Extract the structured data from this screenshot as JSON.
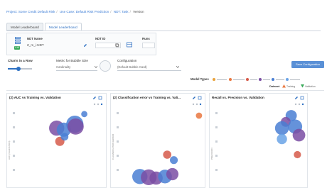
{
  "breadcrumb": {
    "items": [
      "Project: Some Credit Default Risk",
      "Use Case: Default Risk Prediction",
      "NDT: Task",
      "Version"
    ]
  },
  "tabs": [
    {
      "label": "Model Leaderboard",
      "active": false
    },
    {
      "label": "Model Leaderboard",
      "active": true
    }
  ],
  "info": {
    "ndt_name_label": "NDT Name",
    "ndt_name_value": "rt_m_i-NDT",
    "ndt_badge": "CID",
    "ndt_id_label": "NDT ID",
    "runs_label": "Runs"
  },
  "controls": {
    "charts_in_row_label": "Charts in a Row",
    "charts_in_row_value": 0.45,
    "metric_size_label": "Metric for Bubble Size",
    "metric_size_value": "Cardinality",
    "config_label": "Configuration",
    "config_value": "(Default Bubble Card)",
    "save_button_label": "Save Configuration"
  },
  "legend": {
    "model_types_label": "Model Types",
    "dataset_label": "Dataset",
    "dataset_train_label": "Training",
    "dataset_val_label": "Validation"
  },
  "colors": {
    "blue": "#4a7fd4",
    "light_blue": "#6aa3e6",
    "purple": "#7a4ea3",
    "orange": "#e9773f",
    "red": "#d65a4a",
    "green": "#3aaa5a",
    "accent": "#2c6fc2"
  },
  "panels": [
    {
      "title": "(2) AUC vs Training vs. Validation",
      "ylabel": "AUC (VALIDATION)",
      "chart_data": {
        "type": "scatter",
        "title": "(2) AUC vs Training vs. Validation",
        "ylabel": "AUC (VALIDATION)",
        "xlim": [
          0,
          1
        ],
        "ylim": [
          0,
          1
        ],
        "points": [
          {
            "x": 0.43,
            "y": 0.74,
            "size": 0.55,
            "color": "purple"
          },
          {
            "x": 0.52,
            "y": 0.72,
            "size": 0.5,
            "color": "blue"
          },
          {
            "x": 0.66,
            "y": 0.79,
            "size": 0.65,
            "color": "blue"
          },
          {
            "x": 0.67,
            "y": 0.76,
            "size": 0.6,
            "color": "purple"
          },
          {
            "x": 0.47,
            "y": 0.57,
            "size": 0.25,
            "color": "red"
          },
          {
            "x": 0.53,
            "y": 0.63,
            "size": 0.17,
            "color": "blue"
          },
          {
            "x": 0.78,
            "y": 0.92,
            "size": 0.1,
            "color": "blue"
          }
        ]
      }
    },
    {
      "title": "(2) Classification error vs Training vs. Vali...",
      "ylabel": "CLASSIFICATION ERROR",
      "chart_data": {
        "type": "scatter",
        "title": "(2) Classification error vs Training vs. Vali...",
        "ylabel": "CLASSIFICATION ERROR",
        "xlim": [
          0,
          1
        ],
        "ylim": [
          0,
          1
        ],
        "points": [
          {
            "x": 0.18,
            "y": 0.12,
            "size": 0.55,
            "color": "blue"
          },
          {
            "x": 0.3,
            "y": 0.11,
            "size": 0.58,
            "color": "purple"
          },
          {
            "x": 0.4,
            "y": 0.1,
            "size": 0.45,
            "color": "purple"
          },
          {
            "x": 0.52,
            "y": 0.12,
            "size": 0.48,
            "color": "blue"
          },
          {
            "x": 0.62,
            "y": 0.15,
            "size": 0.4,
            "color": "purple"
          },
          {
            "x": 0.55,
            "y": 0.4,
            "size": 0.2,
            "color": "red"
          },
          {
            "x": 0.64,
            "y": 0.33,
            "size": 0.18,
            "color": "blue"
          },
          {
            "x": 0.98,
            "y": 0.9,
            "size": 0.1,
            "color": "orange"
          }
        ]
      }
    },
    {
      "title": "Recall vs. Precision vs. Validation",
      "ylabel": "PRECISION",
      "chart_data": {
        "type": "scatter",
        "title": "Recall vs. Precision vs. Validation",
        "ylabel": "PRECISION",
        "xlim": [
          0,
          1
        ],
        "ylim": [
          0,
          1
        ],
        "points": [
          {
            "x": 0.85,
            "y": 0.9,
            "size": 0.35,
            "color": "blue"
          },
          {
            "x": 0.78,
            "y": 0.82,
            "size": 0.28,
            "color": "purple"
          },
          {
            "x": 0.73,
            "y": 0.74,
            "size": 0.48,
            "color": "blue"
          },
          {
            "x": 0.9,
            "y": 0.76,
            "size": 0.5,
            "color": "blue"
          },
          {
            "x": 0.95,
            "y": 0.65,
            "size": 0.42,
            "color": "purple"
          },
          {
            "x": 0.73,
            "y": 0.6,
            "size": 0.3,
            "color": "light_blue"
          },
          {
            "x": 0.93,
            "y": 0.4,
            "size": 0.15,
            "color": "red"
          }
        ]
      }
    }
  ]
}
